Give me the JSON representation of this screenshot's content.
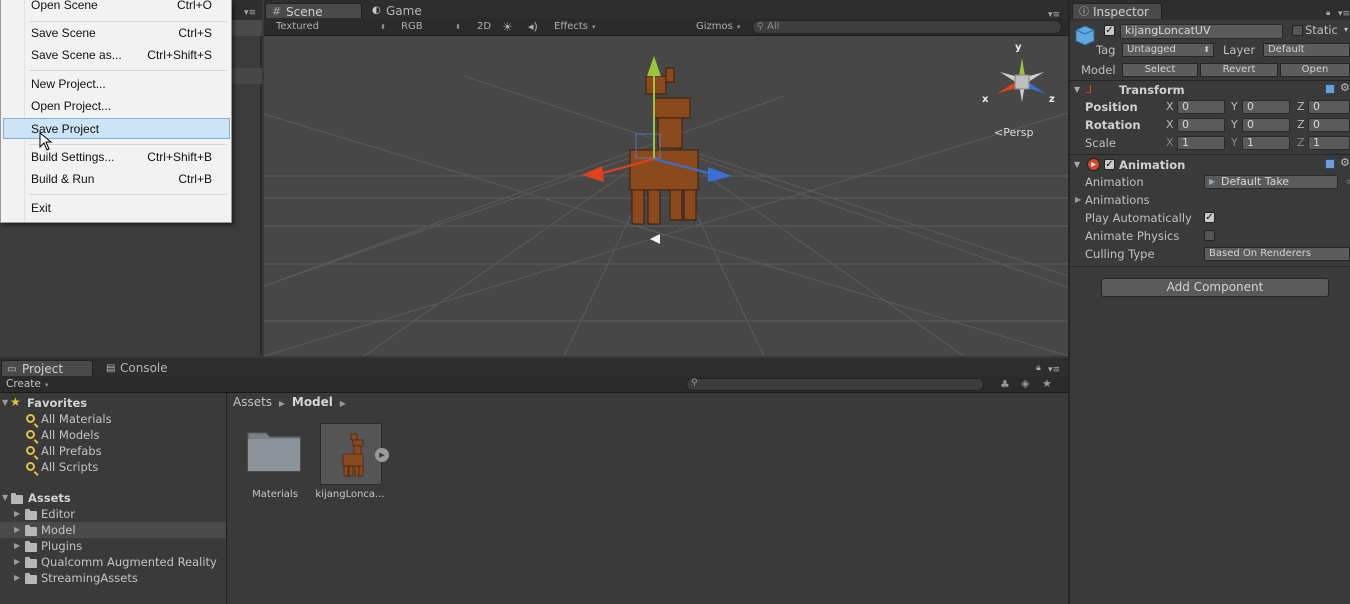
{
  "file_menu": {
    "items": [
      {
        "label": "Open Scene",
        "shortcut": "Ctrl+O"
      },
      {
        "label": "Save Scene",
        "shortcut": "Ctrl+S"
      },
      {
        "label": "Save Scene as...",
        "shortcut": "Ctrl+Shift+S"
      },
      {
        "label": "New Project...",
        "shortcut": ""
      },
      {
        "label": "Open Project...",
        "shortcut": ""
      },
      {
        "label": "Save Project",
        "shortcut": ""
      },
      {
        "label": "Build Settings...",
        "shortcut": "Ctrl+Shift+B"
      },
      {
        "label": "Build & Run",
        "shortcut": "Ctrl+B"
      },
      {
        "label": "Exit",
        "shortcut": ""
      }
    ],
    "highlighted": "Save Project"
  },
  "scene_view": {
    "tabs": [
      {
        "label": "Scene"
      },
      {
        "label": "Game"
      }
    ],
    "toolbar": {
      "shading": "Textured",
      "render_mode": "RGB",
      "mode_2d": "2D",
      "effects": "Effects",
      "gizmos": "Gizmos",
      "search_placeholder": "All"
    },
    "gizmo_axes": {
      "y": "y",
      "x": "x",
      "z": "z"
    },
    "projection": "Persp"
  },
  "project_panel": {
    "tabs": [
      {
        "label": "Project"
      },
      {
        "label": "Console"
      }
    ],
    "create_label": "Create",
    "favorites": {
      "title": "Favorites",
      "items": [
        "All Materials",
        "All Models",
        "All Prefabs",
        "All Scripts"
      ]
    },
    "assets": {
      "title": "Assets",
      "folders": [
        "Editor",
        "Model",
        "Plugins",
        "Qualcomm Augmented Reality",
        "StreamingAssets"
      ],
      "selected": "Model"
    },
    "breadcrumb": [
      "Assets",
      "Model"
    ],
    "grid_items": [
      {
        "label": "Materials",
        "icon": "folder-icon"
      },
      {
        "label": "kijangLonca...",
        "icon": "model-thumbnail"
      }
    ]
  },
  "inspector": {
    "tab_label": "Inspector",
    "object_name": "kijangLoncatUV",
    "static_label": "Static",
    "tag_label": "Tag",
    "tag_value": "Untagged",
    "layer_label": "Layer",
    "layer_value": "Default",
    "model_label": "Model",
    "model_buttons": [
      "Select",
      "Revert",
      "Open"
    ],
    "transform": {
      "title": "Transform",
      "rows": [
        {
          "label": "Position",
          "x": "0",
          "y": "0",
          "z": "0"
        },
        {
          "label": "Rotation",
          "x": "0",
          "y": "0",
          "z": "0"
        },
        {
          "label": "Scale",
          "x": "1",
          "y": "1",
          "z": "1"
        }
      ],
      "axis_labels": [
        "X",
        "Y",
        "Z"
      ]
    },
    "animation": {
      "title": "Animation",
      "animation_label": "Animation",
      "animation_value": "Default Take",
      "animations_label": "Animations",
      "play_automatically_label": "Play Automatically",
      "play_automatically": true,
      "animate_physics_label": "Animate Physics",
      "animate_physics": false,
      "culling_type_label": "Culling Type",
      "culling_type_value": "Based On Renderers"
    },
    "add_component_label": "Add Component"
  },
  "colors": {
    "menu_highlight": "#cde4f7",
    "scene_bg": "#474747",
    "gizmo_y": "#9ac43a",
    "gizmo_x": "#e2421b",
    "gizmo_z": "#3a6fd8"
  }
}
